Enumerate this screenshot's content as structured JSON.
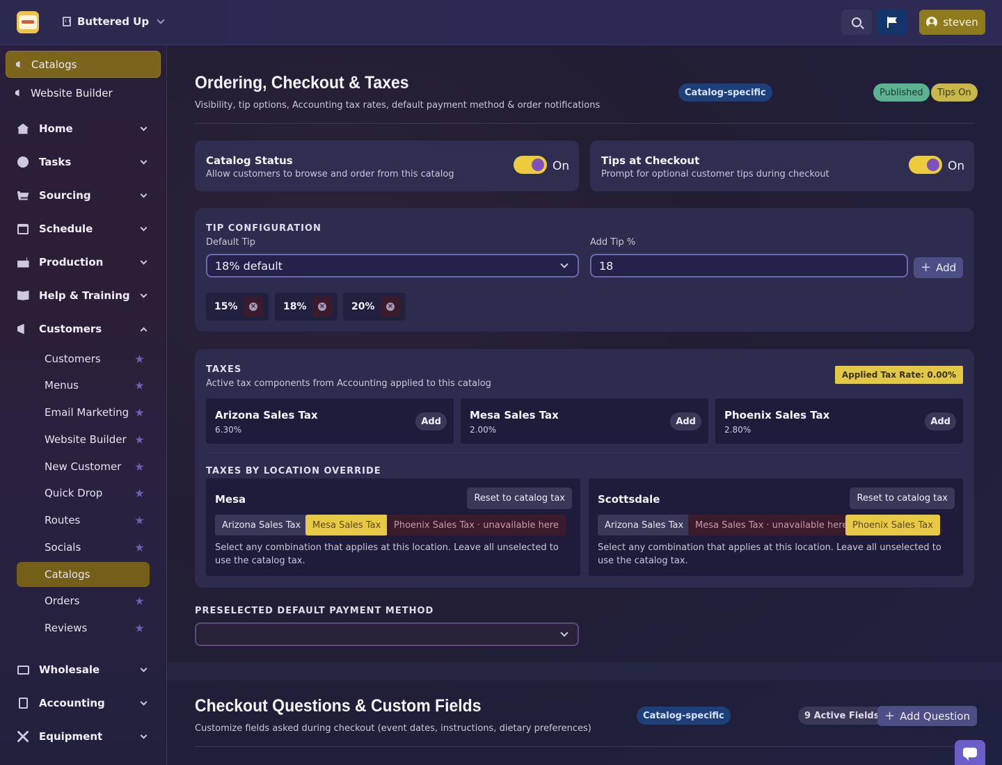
{
  "topbar": {
    "org_name": "Buttered Up",
    "user_name": "steven",
    "icons": {
      "search": "search-icon",
      "flag": "flag-icon",
      "user": "user-circle-icon",
      "org": "building-icon"
    },
    "colors": {
      "user_button": "#8f7a1e",
      "flag_button": "#13356b"
    }
  },
  "sidebar": {
    "pinned": [
      {
        "label": "Catalogs",
        "active": true
      },
      {
        "label": "Website Builder",
        "active": false
      }
    ],
    "sections": [
      {
        "label": "Home",
        "icon": "home-icon",
        "expanded": false
      },
      {
        "label": "Tasks",
        "icon": "check-circle-icon",
        "expanded": false
      },
      {
        "label": "Sourcing",
        "icon": "cart-icon",
        "expanded": false
      },
      {
        "label": "Schedule",
        "icon": "calendar-icon",
        "expanded": false
      },
      {
        "label": "Production",
        "icon": "cake-icon",
        "expanded": false
      },
      {
        "label": "Help & Training",
        "icon": "book-icon",
        "expanded": false
      },
      {
        "label": "Customers",
        "icon": "megaphone-icon",
        "expanded": true
      },
      {
        "label": "Wholesale",
        "icon": "money-icon",
        "expanded": false
      },
      {
        "label": "Accounting",
        "icon": "ledger-icon",
        "expanded": false
      },
      {
        "label": "Equipment",
        "icon": "tools-icon",
        "expanded": false
      }
    ],
    "customers_items": [
      {
        "label": "Customers",
        "active": false
      },
      {
        "label": "Menus",
        "active": false
      },
      {
        "label": "Email Marketing",
        "active": false
      },
      {
        "label": "Website Builder",
        "active": false
      },
      {
        "label": "New Customer",
        "active": false
      },
      {
        "label": "Quick Drop",
        "active": false
      },
      {
        "label": "Routes",
        "active": false
      },
      {
        "label": "Socials",
        "active": false
      },
      {
        "label": "Catalogs",
        "active": true
      },
      {
        "label": "Orders",
        "active": false
      },
      {
        "label": "Reviews",
        "active": false
      }
    ]
  },
  "ordering": {
    "title": "Ordering, Checkout & Taxes",
    "subtitle": "Visibility, tip options, Accounting tax rates, default payment method & order notifications",
    "scope_badge": "Catalog-specific",
    "status_badges": [
      "Published",
      "Tips On"
    ],
    "catalog_status": {
      "title": "Catalog Status",
      "description": "Allow customers to browse and order from this catalog",
      "toggle_label": "On"
    },
    "tips_at_checkout": {
      "title": "Tips at Checkout",
      "description": "Prompt for optional customer tips during checkout",
      "toggle_label": "On"
    },
    "tip_config": {
      "heading": "TIP CONFIGURATION",
      "default_tip_label": "Default Tip",
      "default_tip_value": "18% default",
      "add_tip_label": "Add Tip %",
      "add_tip_value": "18",
      "add_button": "Add",
      "tip_options": [
        "15%",
        "18%",
        "20%"
      ]
    },
    "taxes": {
      "heading": "TAXES",
      "subtitle": "Active tax components from Accounting applied to this catalog",
      "applied_rate": "Applied Tax Rate: 0.00%",
      "components": [
        {
          "name": "Arizona Sales Tax",
          "rate": "6.30%",
          "action": "Add"
        },
        {
          "name": "Mesa Sales Tax",
          "rate": "2.00%",
          "action": "Add"
        },
        {
          "name": "Phoenix Sales Tax",
          "rate": "2.80%",
          "action": "Add"
        }
      ],
      "override_heading": "TAXES BY LOCATION OVERRIDE",
      "locations": [
        {
          "name": "Mesa",
          "reset_label": "Reset to catalog tax",
          "chips": [
            {
              "label": "Arizona Sales Tax",
              "state": "neutral"
            },
            {
              "label": "Mesa Sales Tax",
              "state": "selected"
            },
            {
              "label": "Phoenix Sales Tax · unavailable here",
              "state": "unavailable"
            }
          ],
          "note": "Select any combination that applies at this location. Leave all unselected to use the catalog tax."
        },
        {
          "name": "Scottsdale",
          "reset_label": "Reset to catalog tax",
          "chips": [
            {
              "label": "Arizona Sales Tax",
              "state": "neutral"
            },
            {
              "label": "Mesa Sales Tax · unavailable here",
              "state": "unavailable"
            },
            {
              "label": "Phoenix Sales Tax",
              "state": "selected"
            }
          ],
          "note": "Select any combination that applies at this location. Leave all unselected to use the catalog tax."
        }
      ]
    },
    "payment": {
      "heading": "PRESELECTED DEFAULT PAYMENT METHOD",
      "value": ""
    }
  },
  "checkout_questions": {
    "title": "Checkout Questions & Custom Fields",
    "subtitle": "Customize fields asked during checkout (event dates, instructions, dietary preferences)",
    "scope_badge": "Catalog-specific",
    "count_badge": "9 Active Fields",
    "add_button": "Add Question"
  },
  "colors": {
    "accent_gold": "#e8c946",
    "toggle_knob": "#7e52b8",
    "unavailable": "#3b1a2c"
  }
}
